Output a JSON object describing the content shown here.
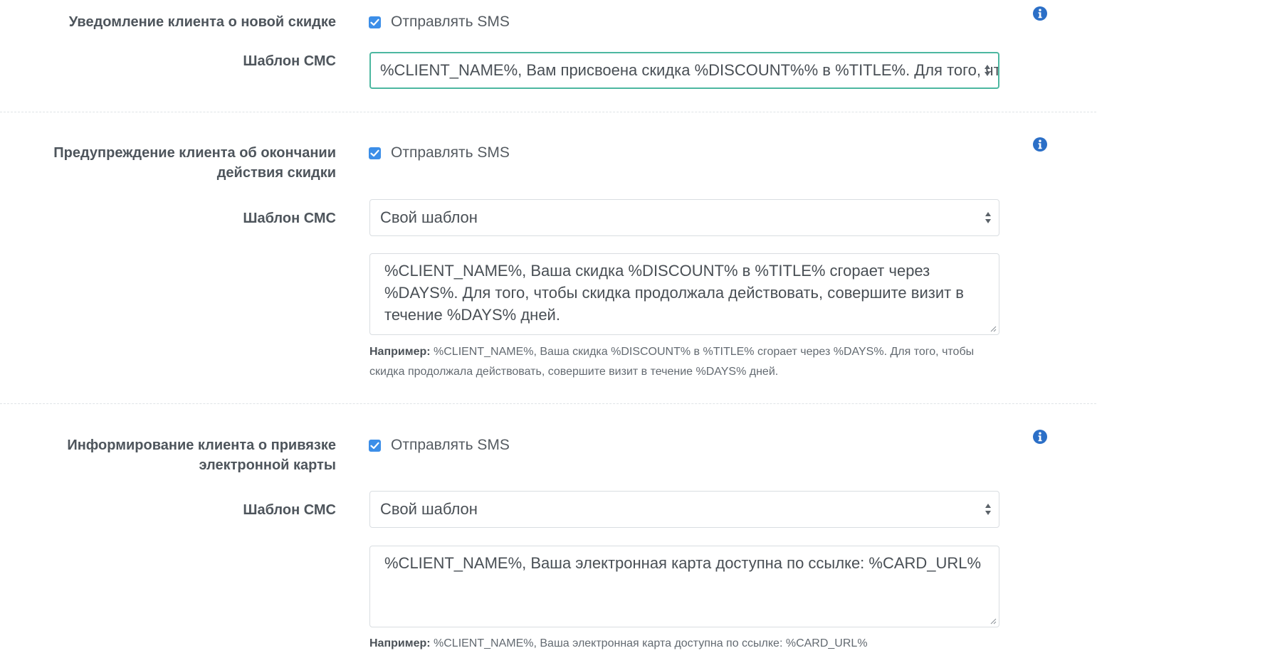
{
  "sections": [
    {
      "label": "Уведомление клиента о новой скидке",
      "checkbox_label": "Отправлять SMS",
      "checked": true,
      "template_label": "Шаблон СМС",
      "template_value": "%CLIENT_NAME%, Вам присвоена скидка %DISCOUNT%% в %TITLE%. Для того, что"
    },
    {
      "label_line1": "Предупреждение клиента об окончании",
      "label_line2": "действия скидки",
      "checkbox_label": "Отправлять SMS",
      "checked": true,
      "template_label": "Шаблон СМС",
      "template_value": "Свой шаблон",
      "text": "%CLIENT_NAME%, Ваша скидка %DISCOUNT% в %TITLE% сгорает через %DAYS%. Для того, чтобы скидка продолжала действовать, совершите визит в течение %DAYS% дней.",
      "example_prefix": "Например:",
      "example_text": " %CLIENT_NAME%, Ваша скидка %DISCOUNT% в %TITLE% сгорает через %DAYS%. Для того, чтобы скидка продолжала действовать, совершите визит в течение %DAYS% дней."
    },
    {
      "label_line1": "Информирование клиента о привязке",
      "label_line2": "электронной карты",
      "checkbox_label": "Отправлять SMS",
      "checked": true,
      "template_label": "Шаблон СМС",
      "template_value": "Свой шаблон",
      "text": "%CLIENT_NAME%, Ваша электронная карта доступна по ссылке: %CARD_URL%",
      "example_prefix": "Например:",
      "example_text": " %CLIENT_NAME%, Ваша электронная карта доступна по ссылке: %CARD_URL%"
    }
  ],
  "icons": {
    "info": "info-icon",
    "checkbox": "check-icon",
    "select_arrows": "select-arrows-icon",
    "resize": "resize-handle-icon"
  },
  "colors": {
    "checkbox": "#3c8ee8",
    "info": "#2b6fc7",
    "focus_border": "#4cb7a0"
  }
}
